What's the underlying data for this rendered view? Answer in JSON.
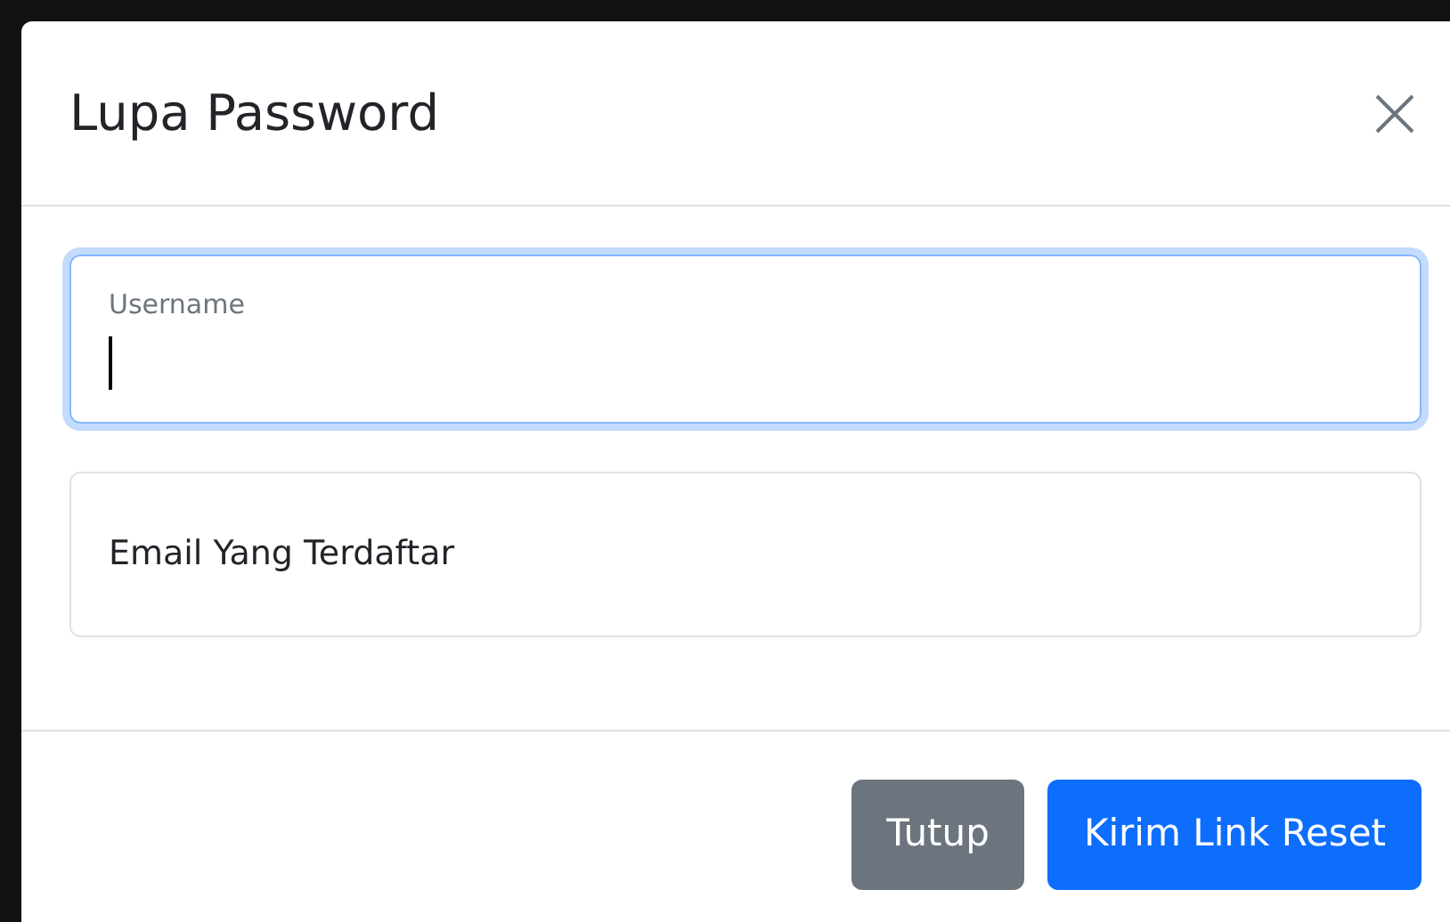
{
  "dialog": {
    "title": "Lupa Password",
    "fields": [
      {
        "label": "Username",
        "focused": true
      },
      {
        "label": "Email Yang Terdaftar",
        "focused": false
      }
    ],
    "buttons": [
      {
        "label": "Tutup",
        "kind": "secondary"
      },
      {
        "label": "Kirim Link Reset",
        "kind": "primary"
      }
    ]
  }
}
